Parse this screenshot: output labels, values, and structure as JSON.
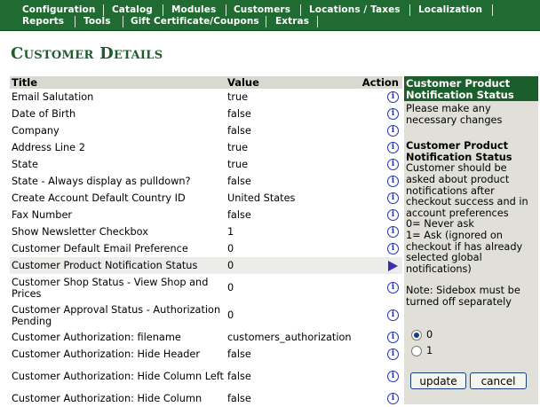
{
  "menu": {
    "row1": [
      "Configuration",
      "Catalog",
      "Modules",
      "Customers",
      "Locations / Taxes",
      "Localization"
    ],
    "row2": [
      "Reports",
      "Tools",
      "Gift Certificate/Coupons",
      "Extras"
    ]
  },
  "page_title": "Customer Details",
  "table": {
    "headers": {
      "title": "Title",
      "value": "Value",
      "action": "Action"
    },
    "rows": [
      {
        "title": "Email Salutation",
        "value": "true"
      },
      {
        "title": "Date of Birth",
        "value": "false"
      },
      {
        "title": "Company",
        "value": "false"
      },
      {
        "title": "Address Line 2",
        "value": "true"
      },
      {
        "title": "State",
        "value": "true"
      },
      {
        "title": "State - Always display as pulldown?",
        "value": "false"
      },
      {
        "title": "Create Account Default Country ID",
        "value": "United States"
      },
      {
        "title": "Fax Number",
        "value": "false"
      },
      {
        "title": "Show Newsletter Checkbox",
        "value": "1"
      },
      {
        "title": "Customer Default Email Preference",
        "value": "0"
      },
      {
        "title": "Customer Product Notification Status",
        "value": "0"
      },
      {
        "title": "Customer Shop Status - View Shop and Prices",
        "value": "0"
      },
      {
        "title": "Customer Approval Status - Authorization Pending",
        "value": "0"
      },
      {
        "title": "Customer Authorization: filename",
        "value": "customers_authorization"
      },
      {
        "title": "Customer Authorization: Hide Header",
        "value": "false"
      },
      {
        "title": "Customer Authorization: Hide Column Left",
        "value": "false"
      },
      {
        "title": "Customer Authorization: Hide Column",
        "value": "false"
      }
    ]
  },
  "sidebox": {
    "header": "Customer Product Notification Status",
    "instruction": "Please make any necessary changes",
    "setting_title": "Customer Product Notification Status",
    "description": "Customer should be asked about product notifications after checkout success and in account preferences",
    "option_0": "0= Never ask",
    "option_1": "1= Ask (ignored on checkout if has already selected global notifications)",
    "note": "Note: Sidebox must be turned off separately",
    "radios": [
      {
        "label": "0",
        "checked": true
      },
      {
        "label": "1",
        "checked": false
      }
    ],
    "update_label": "update",
    "cancel_label": "cancel"
  }
}
